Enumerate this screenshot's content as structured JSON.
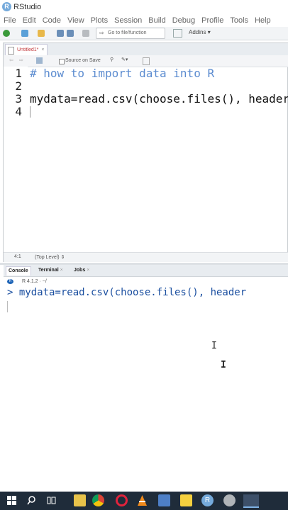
{
  "window": {
    "title": "RStudio"
  },
  "menu": [
    "File",
    "Edit",
    "Code",
    "View",
    "Plots",
    "Session",
    "Build",
    "Debug",
    "Profile",
    "Tools",
    "Help"
  ],
  "toolbar": {
    "goto_placeholder": "Go to file/function",
    "addins_label": "Addins"
  },
  "editor": {
    "tab_label": "Untitled1*",
    "source_on_save_label": "Source on Save",
    "lines": [
      {
        "num": "1",
        "text": "# how to import data into R",
        "kind": "comment"
      },
      {
        "num": "2",
        "text": "",
        "kind": "plain"
      },
      {
        "num": "3",
        "text": "mydata=read.csv(choose.files(), header",
        "kind": "plain"
      },
      {
        "num": "4",
        "text": "",
        "kind": "plain"
      }
    ],
    "status_position": "4:1",
    "status_scope": "(Top Level)"
  },
  "console": {
    "tabs": [
      "Console",
      "Terminal",
      "Jobs"
    ],
    "r_version": "R 4.1.2 · ~/",
    "command_line": "> mydata=read.csv(choose.files(), header"
  },
  "taskbar": {
    "icons": [
      "windows-start-icon",
      "search-icon",
      "task-view-icon",
      "file-explorer-icon",
      "chrome-icon",
      "opera-icon",
      "vlc-icon",
      "settings-icon",
      "vscode-icon",
      "sticky-notes-icon",
      "rstudio-icon",
      "camera-icon",
      "active-window-icon"
    ]
  },
  "colors": {
    "comment": "#5c8cd0",
    "console_text": "#1b4fa0",
    "taskbar": "#1f2c3a"
  }
}
